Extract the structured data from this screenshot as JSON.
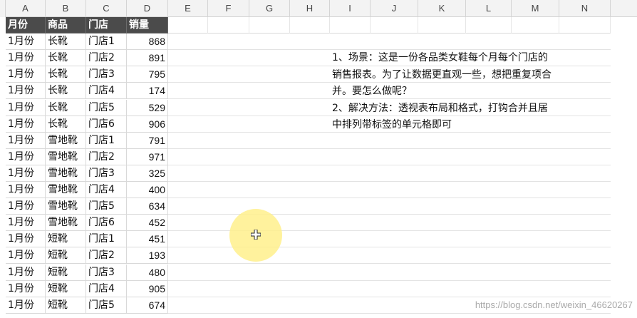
{
  "columns": [
    "A",
    "B",
    "C",
    "D",
    "E",
    "F",
    "G",
    "H",
    "I",
    "J",
    "K",
    "L",
    "M",
    "N"
  ],
  "table": {
    "headers": [
      "月份",
      "商品",
      "门店",
      "销量"
    ],
    "rows": [
      [
        "1月份",
        "长靴",
        "门店1",
        "868"
      ],
      [
        "1月份",
        "长靴",
        "门店2",
        "891"
      ],
      [
        "1月份",
        "长靴",
        "门店3",
        "795"
      ],
      [
        "1月份",
        "长靴",
        "门店4",
        "174"
      ],
      [
        "1月份",
        "长靴",
        "门店5",
        "529"
      ],
      [
        "1月份",
        "长靴",
        "门店6",
        "906"
      ],
      [
        "1月份",
        "雪地靴",
        "门店1",
        "791"
      ],
      [
        "1月份",
        "雪地靴",
        "门店2",
        "971"
      ],
      [
        "1月份",
        "雪地靴",
        "门店3",
        "325"
      ],
      [
        "1月份",
        "雪地靴",
        "门店4",
        "400"
      ],
      [
        "1月份",
        "雪地靴",
        "门店5",
        "634"
      ],
      [
        "1月份",
        "雪地靴",
        "门店6",
        "452"
      ],
      [
        "1月份",
        "短靴",
        "门店1",
        "451"
      ],
      [
        "1月份",
        "短靴",
        "门店2",
        "193"
      ],
      [
        "1月份",
        "短靴",
        "门店3",
        "480"
      ],
      [
        "1月份",
        "短靴",
        "门店4",
        "905"
      ],
      [
        "1月份",
        "短靴",
        "门店5",
        "674"
      ]
    ]
  },
  "note": {
    "lines": [
      "1、场景：这是一份各品类女鞋每个月每个门店的",
      "销售报表。为了让数据更直观一些，想把重复项合",
      "并。要怎么做呢？",
      "2、解决方法：透视表布局和格式，打钩合并且居",
      "中排列带标签的单元格即可"
    ]
  },
  "watermark": "https://blog.csdn.net/weixin_46620267",
  "colors": {
    "header_bg": "#4b4b4b",
    "header_text": "#ffffff",
    "grid_line": "#d9d9d9",
    "cursor_highlight": "#fff08c"
  },
  "icons": {
    "cursor": "cell-select-cross-icon"
  }
}
